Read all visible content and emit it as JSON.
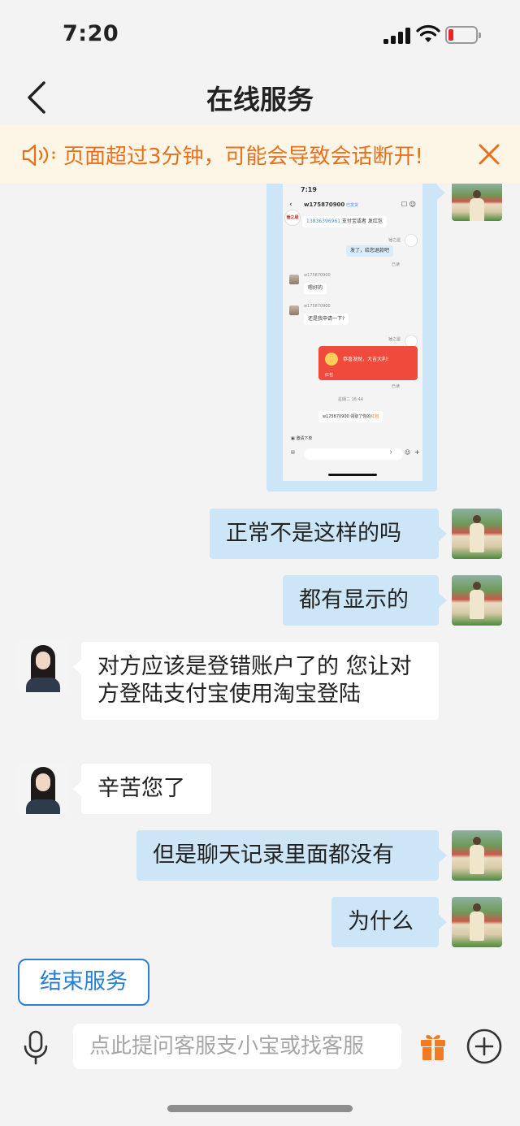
{
  "status_bar": {
    "time": "7:20"
  },
  "nav": {
    "title": "在线服务"
  },
  "notice": {
    "text": "页面超过3分钟，可能会导致会话断开!"
  },
  "screenshot": {
    "time": "7:19",
    "contact": "w175870900",
    "contact_tag": "已发货",
    "msg1_phone": "13836396961",
    "msg1_rest": "支付宝或者 发红包",
    "sender": "锤之屋",
    "msg2": "发了，给您退款吧",
    "read1": "已读",
    "user": "w175870900",
    "msg3": "嗯好的",
    "msg4": "还是我申请一下?",
    "red_packet": "恭喜发财，大吉大利!",
    "red_packet_label": "红包",
    "read2": "已读",
    "timestamp": "星期二 16:44",
    "claim_prefix": "w175870900 领取了你的",
    "claim_link": "红包",
    "invite": "邀请下单",
    "logo_text": "锤之屋"
  },
  "messages": [
    {
      "side": "right",
      "text": "正常不是这样的吗"
    },
    {
      "side": "right",
      "text": "都有显示的"
    },
    {
      "side": "left",
      "text": "对方应该是登错账户了的 您让对方登陆支付宝使用淘宝登陆"
    },
    {
      "side": "left",
      "text": "辛苦您了"
    },
    {
      "side": "right",
      "text": "但是聊天记录里面都没有"
    },
    {
      "side": "right",
      "text": "为什么"
    }
  ],
  "end_service_label": "结束服务",
  "input": {
    "placeholder": "点此提问客服支小宝或找客服"
  },
  "colors": {
    "accent": "#2a7fd4",
    "notice_text": "#e8701c",
    "notice_bg": "#fdf6e6",
    "bubble_right": "#cde6f7",
    "bubble_left": "#ffffff"
  }
}
